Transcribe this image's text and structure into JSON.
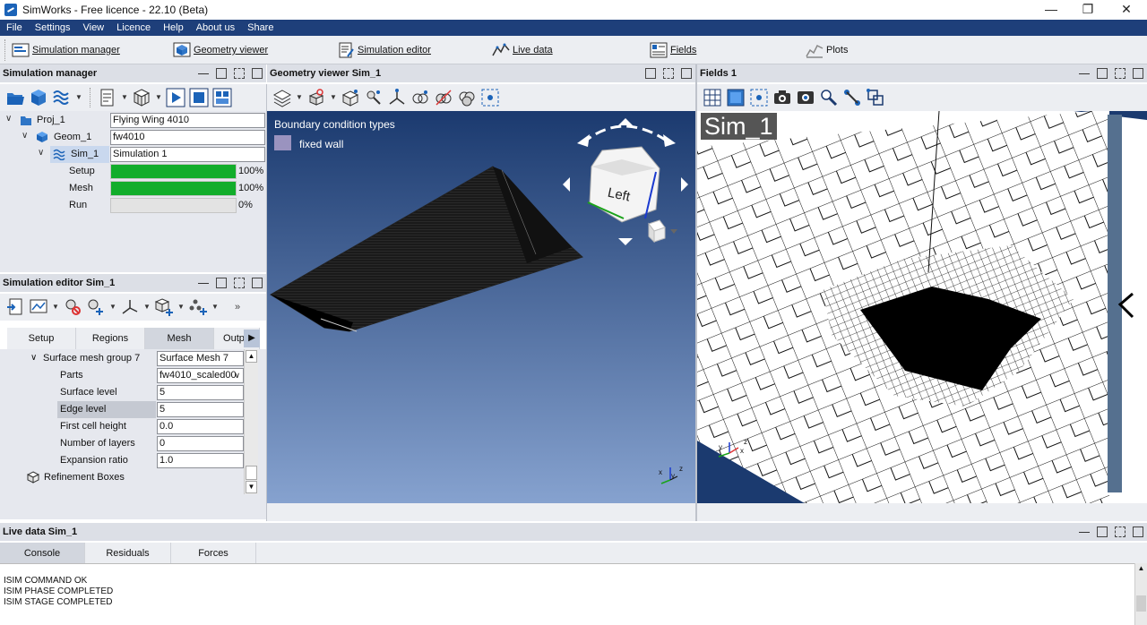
{
  "window": {
    "title": "SimWorks - Free licence - 22.10 (Beta)"
  },
  "menu": [
    "File",
    "Settings",
    "View",
    "Licence",
    "Help",
    "About us",
    "Share"
  ],
  "toolbar": {
    "simulation_manager": "Simulation manager",
    "geometry_viewer": "Geometry viewer",
    "simulation_editor": "Simulation editor",
    "live_data": "Live data",
    "fields": "Fields",
    "plots": "Plots"
  },
  "panels": {
    "simulation_manager": "Simulation manager",
    "geometry_viewer": "Geometry viewer Sim_1",
    "fields": "Fields 1",
    "simulation_editor": "Simulation editor Sim_1",
    "live_data": "Live data Sim_1"
  },
  "tree": {
    "proj": {
      "name": "Proj_1",
      "value": "Flying Wing 4010"
    },
    "geom": {
      "name": "Geom_1",
      "value": "fw4010"
    },
    "sim": {
      "name": "Sim_1",
      "value": "Simulation 1"
    },
    "progress": [
      {
        "label": "Setup",
        "percent": 100,
        "text": "100%"
      },
      {
        "label": "Mesh",
        "percent": 100,
        "text": "100%"
      },
      {
        "label": "Run",
        "percent": 0,
        "text": "0%"
      }
    ]
  },
  "editor": {
    "tabs": [
      "Setup",
      "Regions",
      "Mesh",
      "Outpu"
    ],
    "active_tab": "Mesh",
    "group": {
      "label": "Surface mesh group 7",
      "value": "Surface Mesh 7"
    },
    "props": [
      {
        "label": "Parts",
        "value": "fw4010_scaled00"
      },
      {
        "label": "Surface level",
        "value": "5"
      },
      {
        "label": "Edge level",
        "value": "5"
      },
      {
        "label": "First cell height",
        "value": "0.0"
      },
      {
        "label": "Number of layers",
        "value": "0"
      },
      {
        "label": "Expansion ratio",
        "value": "1.0"
      }
    ],
    "refinement": "Refinement Boxes"
  },
  "geometry": {
    "legend_title": "Boundary condition types",
    "legend_item": "fixed wall",
    "legend_color": "#9a93bf",
    "view_cube_face": "Left"
  },
  "fields_view": {
    "label": "Sim_1"
  },
  "live_data": {
    "tabs": [
      "Console",
      "Residuals",
      "Forces"
    ],
    "active_tab": "Console",
    "console_lines": [
      "ISIM COMMAND OK",
      "ISIM PHASE COMPLETED",
      "ISIM STAGE COMPLETED"
    ]
  },
  "colors": {
    "menubar": "#1e3f7a",
    "progress": "#12ad2b",
    "accent": "#1b63b8"
  }
}
